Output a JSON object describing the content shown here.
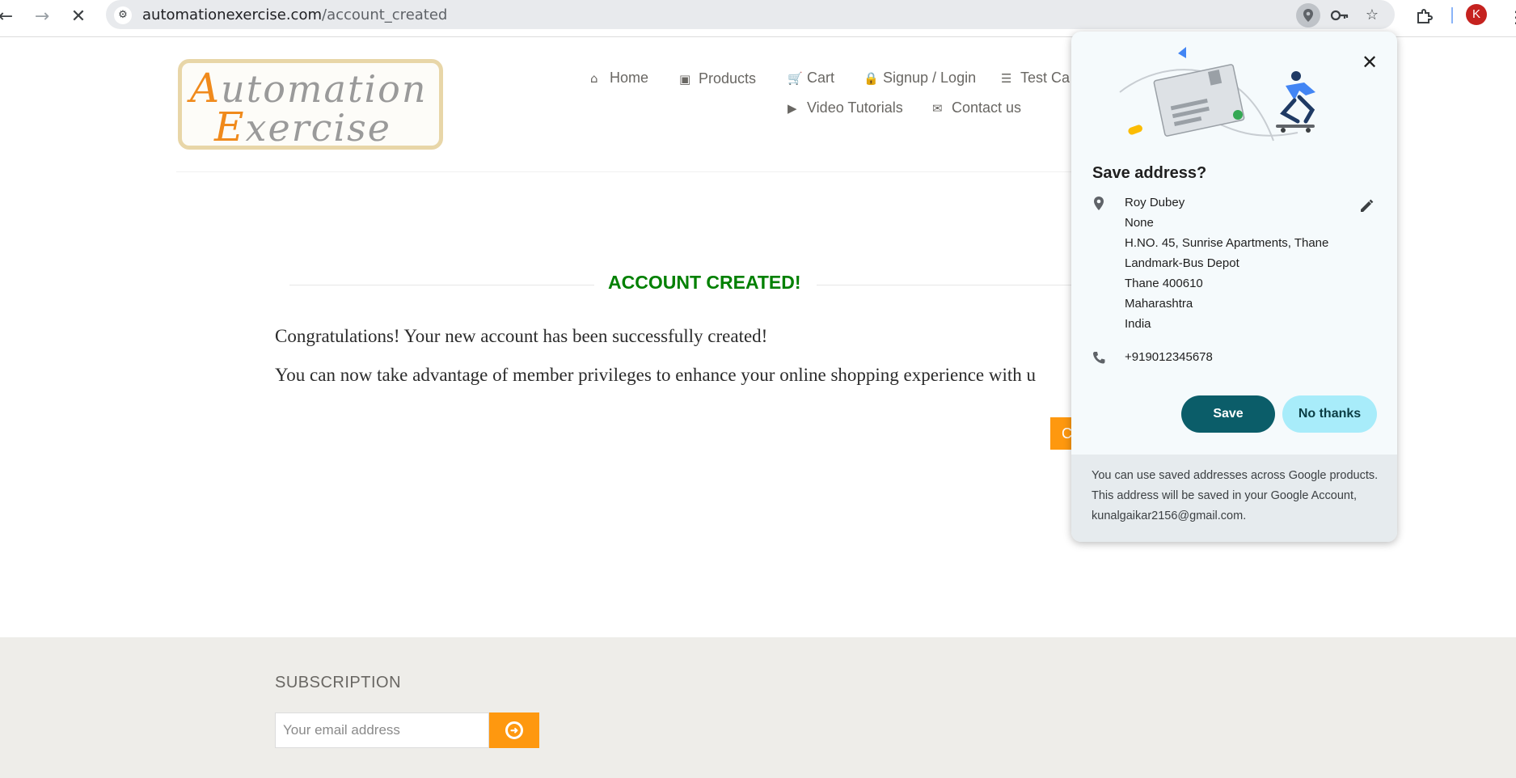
{
  "browser": {
    "url_domain": "automationexercise.com",
    "url_path": "/account_created",
    "back_icon": "arrow-left-icon",
    "forward_icon": "arrow-right-icon",
    "stop_icon": "close-icon",
    "profile_initial": "K"
  },
  "header": {
    "logo_line1": "Automation",
    "logo_line2": "Exercise",
    "nav": {
      "home": "Home",
      "products": "Products",
      "cart": "Cart",
      "signup": "Signup / Login",
      "test_cases": "Test Ca",
      "video": "Video Tutorials",
      "contact": "Contact us"
    }
  },
  "main": {
    "title": "ACCOUNT CREATED!",
    "message1": "Congratulations! Your new account has been successfully created!",
    "message2": "You can now take advantage of member privileges to enhance your online shopping experience with u",
    "continue_label": "C"
  },
  "footer": {
    "subscription_title": "SUBSCRIPTION",
    "email_placeholder": "Your email address"
  },
  "popup": {
    "title": "Save address?",
    "address_lines": [
      "Roy Dubey",
      "None",
      "H.NO. 45, Sunrise Apartments, Thane",
      "Landmark-Bus Depot",
      "Thane 400610",
      "Maharashtra",
      "India"
    ],
    "phone": "+919012345678",
    "save_label": "Save",
    "no_thanks_label": "No thanks",
    "footer_text": "You can use saved addresses across Google products. This address will be saved in your Google Account, kunalgaikar2156@gmail.com.",
    "colors": {
      "save": "#0b5d69",
      "no_thanks": "#a8ecfa"
    }
  },
  "colors": {
    "accent_orange": "#fe980f",
    "success_green": "#008000"
  }
}
